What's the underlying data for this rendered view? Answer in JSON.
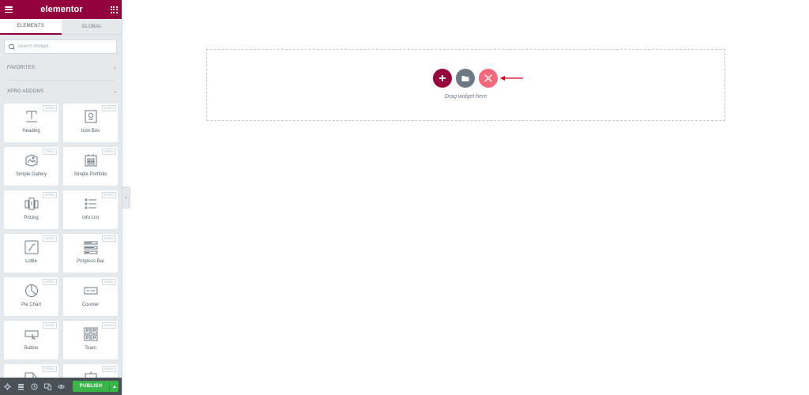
{
  "app": {
    "brand": "elementor"
  },
  "tabs": [
    {
      "label": "ELEMENTS",
      "active": true
    },
    {
      "label": "GLOBAL",
      "active": false
    }
  ],
  "search": {
    "placeholder": "Search Widget..."
  },
  "sections": {
    "favorites": "FAVORITES",
    "xpro_addons": "XPRO ADDONS"
  },
  "widgets": [
    {
      "label": "Heading",
      "badge": "XPRO",
      "icon": "heading-icon"
    },
    {
      "label": "Icon Box",
      "badge": "XPRO",
      "icon": "icon-box-icon"
    },
    {
      "label": "Simple Gallery",
      "badge": "XPRO",
      "icon": "gallery-icon"
    },
    {
      "label": "Simple Portfolio",
      "badge": "XPRO",
      "icon": "portfolio-icon"
    },
    {
      "label": "Pricing",
      "badge": "XPRO",
      "icon": "pricing-icon"
    },
    {
      "label": "Info List",
      "badge": "XPRO",
      "icon": "info-list-icon"
    },
    {
      "label": "Lottie",
      "badge": "XPRO",
      "icon": "lottie-icon"
    },
    {
      "label": "Progress Bar",
      "badge": "XPRO",
      "icon": "progress-bar-icon"
    },
    {
      "label": "Pie Chart",
      "badge": "XPRO",
      "icon": "pie-chart-icon"
    },
    {
      "label": "Counter",
      "badge": "XPRO",
      "icon": "counter-icon"
    },
    {
      "label": "Button",
      "badge": "XPRO",
      "icon": "button-icon"
    },
    {
      "label": "Team",
      "badge": "XPRO",
      "icon": "team-icon"
    },
    {
      "label": "",
      "badge": "XPRO",
      "icon": "widget-icon"
    },
    {
      "label": "",
      "badge": "XPRO",
      "icon": "widget-icon"
    }
  ],
  "bottombar": {
    "publish_label": "PUBLISH",
    "icons": [
      "settings-icon",
      "navigator-icon",
      "history-icon",
      "responsive-icon",
      "preview-icon"
    ]
  },
  "canvas": {
    "drag_label": "Drag widget here"
  },
  "colors": {
    "brand": "#93003c",
    "publish": "#39b54a",
    "xpro": "#f0697c",
    "arrow": "#d0021b"
  }
}
